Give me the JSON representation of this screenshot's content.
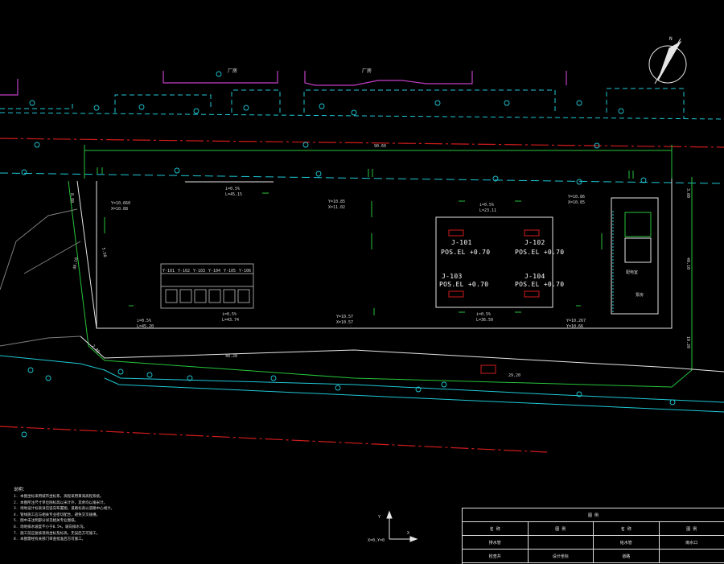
{
  "drawing": {
    "building_labels": [
      "厂房",
      "厂房"
    ],
    "north_arrow": "N",
    "dimensions": {
      "top_overall": "90.60",
      "right_side": "40.10",
      "left_side": "40.10",
      "bottom_left": "48.28",
      "bottom_right": "29.20",
      "right_upper": "3.80",
      "right_lower": "10.20",
      "left_upper": "8.80",
      "left_lower": "2.80",
      "left_diag": "5.50"
    },
    "elevations": [
      {
        "text": "Y=10.660",
        "sub": "X=10.88"
      },
      {
        "text": "Y=10.85",
        "sub": "X=11.02"
      },
      {
        "text": "Y=10.57",
        "sub": "X=10.57"
      },
      {
        "text": "Y=10.86",
        "sub": "X=10.85"
      },
      {
        "text": "Y=10.267",
        "sub": "Y=10.66"
      }
    ],
    "slopes": [
      {
        "text": "i=0.5%",
        "sub": "L=45.15"
      },
      {
        "text": "i=0.5%",
        "sub": "L=23.11"
      },
      {
        "text": "i=0.5%",
        "sub": "L=36.50"
      },
      {
        "text": "i=0.5%",
        "sub": "L=43.74"
      },
      {
        "text": "i=0.5%",
        "sub": "L=45.20"
      }
    ],
    "wells": [
      {
        "id": "J-101",
        "pos": "POS.EL +0.70"
      },
      {
        "id": "J-102",
        "pos": "POS.EL +0.70"
      },
      {
        "id": "J-103",
        "pos": "POS.EL +0.70"
      },
      {
        "id": "J-104",
        "pos": "POS.EL +0.70"
      }
    ],
    "tank_labels": [
      "Y-101",
      "Y-102",
      "Y-103",
      "Y-104",
      "Y-105",
      "Y-106"
    ],
    "room_labels": [
      "配电室",
      "泵房"
    ],
    "axis": {
      "x": "X",
      "y": "Y",
      "origin": "X=0,Y=0"
    }
  },
  "notes": {
    "title": "说明：",
    "lines": [
      "1. 本图坐标采用城市坐标系，高程采用黄海高程系统。",
      "2. 本图所注尺寸单位除标高以米计外，其余均以毫米计。",
      "3. 场地设计标高详见竖向布置图，道路标高以道路中心线计。",
      "4. 管线施工应与相关专业密切配合，避免交叉碰撞。",
      "5. 图中未注明部分详见相关专业图纸。",
      "6. 场地排水坡度不小于0.5%，坡向排水沟。",
      "7. 施工前应复核现场坐标及标高，无误后方可施工。",
      "8. 本图需经有关部门审查批准后方可施工。"
    ]
  },
  "legend": {
    "title": "图 例",
    "rows": [
      [
        "名 称",
        "图 例",
        "名 称",
        "图 例"
      ],
      [
        "排水管",
        "",
        "给水管",
        "雨水口"
      ],
      [
        "检查井",
        "设计坐标",
        "道路",
        ""
      ],
      [
        "",
        "设计标高(相对)",
        "",
        ""
      ]
    ]
  },
  "colors": {
    "background": "#000000",
    "road": "#1fc8d6",
    "boundary": "#27c43a",
    "building": "#c23fc7",
    "redline": "#d11c1c",
    "white": "#e6e6e6"
  }
}
